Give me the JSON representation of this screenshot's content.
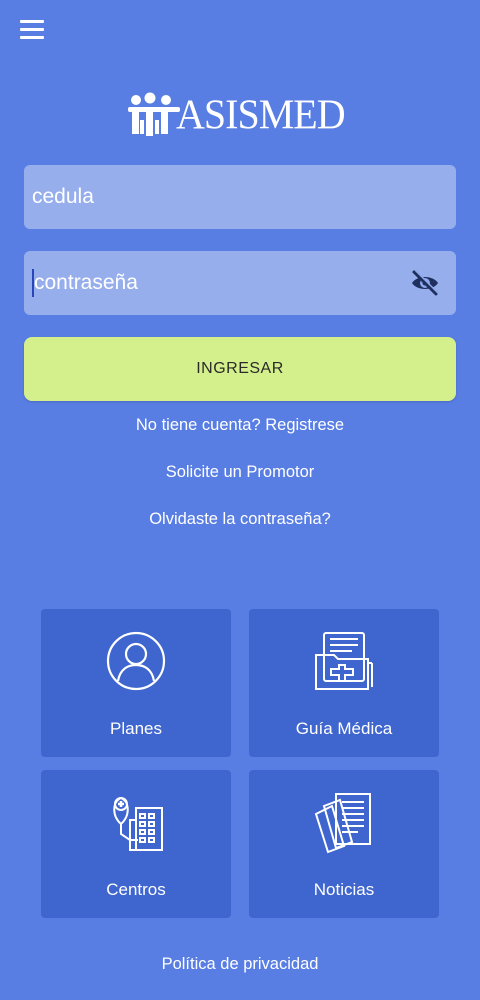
{
  "header": {
    "menu_icon": "hamburger-menu-icon"
  },
  "logo": {
    "text": "ASISMED",
    "icon": "family-people-icon"
  },
  "login_form": {
    "cedula_placeholder": "cedula",
    "password_placeholder": "contraseña",
    "password_toggle_icon": "eye-off-icon",
    "submit_label": "INGRESAR"
  },
  "links": {
    "register": "No tiene cuenta? Registrese",
    "promoter": "Solicite un Promotor",
    "forgot_password": "Olvidaste la contraseña?"
  },
  "tiles": [
    {
      "label": "Planes",
      "icon": "user-circle-icon"
    },
    {
      "label": "Guía Médica",
      "icon": "medical-folder-icon"
    },
    {
      "label": "Centros",
      "icon": "hospital-location-icon"
    },
    {
      "label": "Noticias",
      "icon": "newspaper-icon"
    }
  ],
  "footer": {
    "privacy": "Política de privacidad"
  },
  "colors": {
    "background": "#587DE3",
    "tile": "#3F65CE",
    "primary_button": "#D4F08C"
  }
}
